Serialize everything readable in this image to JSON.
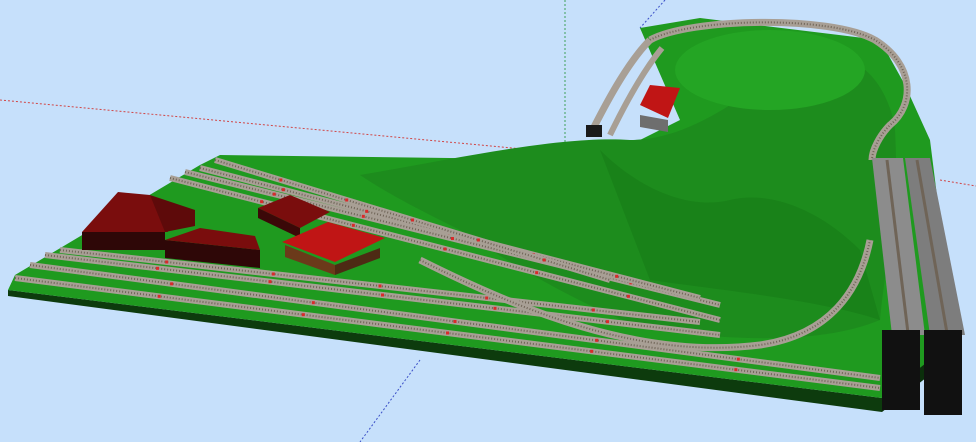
{
  "view": {
    "background_color": "#c6e0fb",
    "axis_colors": {
      "x": "#d14545",
      "y": "#3e9f58",
      "z": "#3a4fc7"
    }
  },
  "layout": {
    "ground_color": "#1f9a1f",
    "hill_color": "#1d8c1d",
    "base_edge_color": "#0d3b0d",
    "track": {
      "rail_color": "#6f6457",
      "ballast_color": "#a89f95",
      "marker_color": "#d92a2a"
    },
    "buildings": [
      {
        "name": "large-station-building",
        "roof_color": "#7a0d0d"
      },
      {
        "name": "goods-shed",
        "roof_color": "#7a0d0d"
      },
      {
        "name": "small-house",
        "roof_color": "#7a0d0d"
      },
      {
        "name": "red-house",
        "roof_color": "#c01515"
      },
      {
        "name": "hill-hut",
        "roof_color": "#c01515"
      }
    ],
    "tunnel_portal_color": "#111111",
    "bridge_color": "#7d7d7d"
  }
}
